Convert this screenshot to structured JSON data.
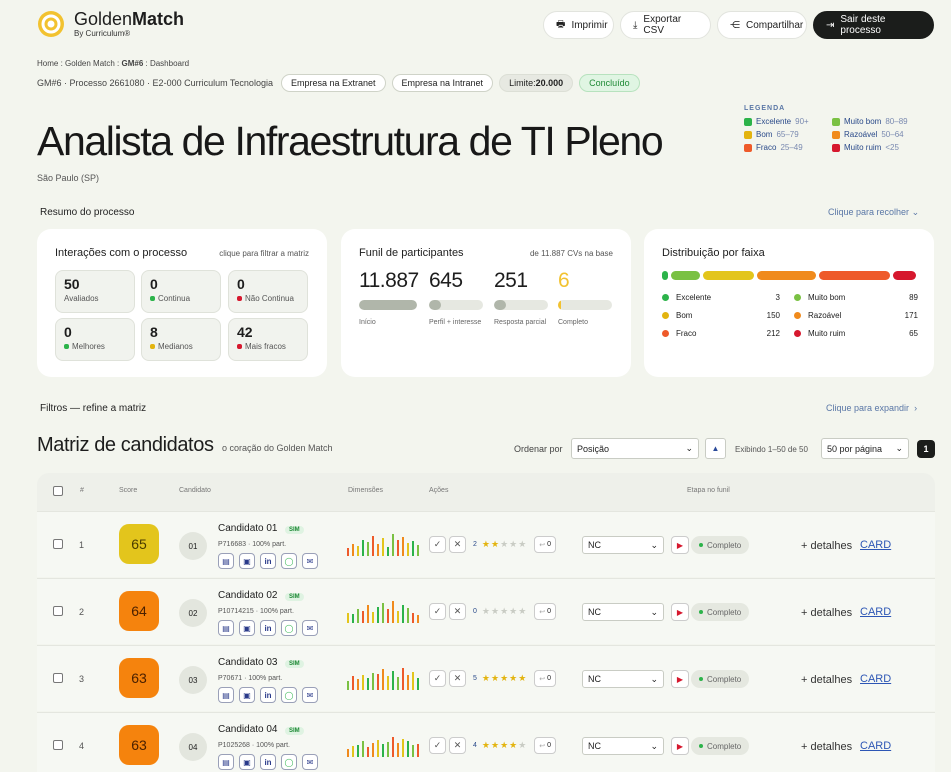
{
  "brand": {
    "name_a": "Golden",
    "name_b": "Match",
    "sub": "By Curriculum®"
  },
  "toolbar": {
    "print": "Imprimir",
    "export": "Exportar CSV",
    "share": "Compartilhar",
    "exit": "Sair deste processo"
  },
  "breadcrumb": {
    "a": "Home : Golden Match : ",
    "b": "GM#6",
    "c": " : Dashboard"
  },
  "process": {
    "info": "GM#6 · Processo 2661080 · E2-000 Curriculum Tecnologia",
    "extranet": "Empresa na Extranet",
    "intranet": "Empresa na Intranet",
    "limit_label": "Limite: ",
    "limit_value": "20.000",
    "status": "Concluído"
  },
  "title": "Analista de Infraestrutura de TI Pleno",
  "location": "São Paulo (SP)",
  "legend": {
    "title": "LEGENDA",
    "items": [
      {
        "label": "Excelente",
        "range": "90+",
        "color": "#2cb34a"
      },
      {
        "label": "Muito bom",
        "range": "80–89",
        "color": "#7ac143"
      },
      {
        "label": "Bom",
        "range": "65–79",
        "color": "#e3b40f"
      },
      {
        "label": "Razoável",
        "range": "50–64",
        "color": "#f08a1c"
      },
      {
        "label": "Fraco",
        "range": "25–49",
        "color": "#ee5a2a"
      },
      {
        "label": "Muito ruim",
        "range": "<25",
        "color": "#d6182e"
      }
    ]
  },
  "summary": {
    "title": "Resumo do processo",
    "collapse": "Clique para recolher"
  },
  "interactions": {
    "title": "Interações com o processo",
    "hint": "clique para filtrar a matriz",
    "boxes": [
      {
        "n": "50",
        "l": "Avaliados",
        "c": ""
      },
      {
        "n": "0",
        "l": "Continua",
        "c": "#2cb34a"
      },
      {
        "n": "0",
        "l": "Não Continua",
        "c": "#d6182e"
      },
      {
        "n": "0",
        "l": "Melhores",
        "c": "#2cb34a"
      },
      {
        "n": "8",
        "l": "Medianos",
        "c": "#e3b40f"
      },
      {
        "n": "42",
        "l": "Mais fracos",
        "c": "#d6182e"
      }
    ]
  },
  "funnel": {
    "title": "Funil de participantes",
    "hint": "de 11.887 CVs na base",
    "stages": [
      {
        "value": "11.887",
        "label": "Início",
        "fill": 1.0
      },
      {
        "value": "645",
        "label": "Perfil + interesse",
        "fill": 0.054
      },
      {
        "value": "251",
        "label": "Resposta parcial",
        "fill": 0.021
      },
      {
        "value": "6",
        "label": "Completo",
        "fill": 0.0005
      }
    ]
  },
  "distribution": {
    "title": "Distribuição por faixa",
    "items": [
      {
        "label": "Excelente",
        "value": "3",
        "color": "#2cb34a"
      },
      {
        "label": "Muito bom",
        "value": "89",
        "color": "#7ac143"
      },
      {
        "label": "Bom",
        "value": "150",
        "color": "#e3b40f"
      },
      {
        "label": "Razoável",
        "value": "171",
        "color": "#f08a1c"
      },
      {
        "label": "Fraco",
        "value": "212",
        "color": "#ee5a2a"
      },
      {
        "label": "Muito ruim",
        "value": "65",
        "color": "#d6182e"
      }
    ]
  },
  "filters": {
    "title": "Filtros — refine a matriz",
    "expand": "Clique para expandir"
  },
  "matrix": {
    "title": "Matriz de candidatos",
    "subtitle": "o coração do Golden Match",
    "order_label": "Ordenar por",
    "order_value": "Posição",
    "showing": "Exibindo 1–50 de 50",
    "per_page": "50 por página",
    "page": "1",
    "headers": {
      "num": "#",
      "score": "Score",
      "cand": "Candidato",
      "dim": "Dimensões",
      "act": "Ações",
      "stage": "Etapa no funil"
    }
  },
  "candidates": [
    {
      "idx": "1",
      "score": "65",
      "color": "#e3c51c",
      "text": "#4a3c00",
      "init": "01",
      "name": "Candidato 01",
      "badge": "SIM",
      "meta": "P716683 · 100% part.",
      "stars": "2",
      "filled": 2,
      "reply": "0",
      "select": "NC",
      "stage": "Completo",
      "details": "+ detalhes",
      "card": "CARD"
    },
    {
      "idx": "2",
      "score": "64",
      "color": "#f5830d",
      "text": "#4a2000",
      "init": "02",
      "name": "Candidato 02",
      "badge": "SIM",
      "meta": "P10714215 · 100% part.",
      "stars": "0",
      "filled": 0,
      "reply": "0",
      "select": "NC",
      "stage": "Completo",
      "details": "+ detalhes",
      "card": "CARD"
    },
    {
      "idx": "3",
      "score": "63",
      "color": "#f5830d",
      "text": "#4a2000",
      "init": "03",
      "name": "Candidato 03",
      "badge": "SIM",
      "meta": "P70671 · 100% part.",
      "stars": "5",
      "filled": 5,
      "reply": "0",
      "select": "NC",
      "stage": "Completo",
      "details": "+ detalhes",
      "card": "CARD"
    },
    {
      "idx": "4",
      "score": "63",
      "color": "#f5830d",
      "text": "#4a2000",
      "init": "04",
      "name": "Candidato 04",
      "badge": "SIM",
      "meta": "P1025268 · 100% part.",
      "stars": "4",
      "filled": 4,
      "reply": "0",
      "select": "NC",
      "stage": "Completo",
      "details": "+ detalhes",
      "card": "CARD"
    }
  ]
}
